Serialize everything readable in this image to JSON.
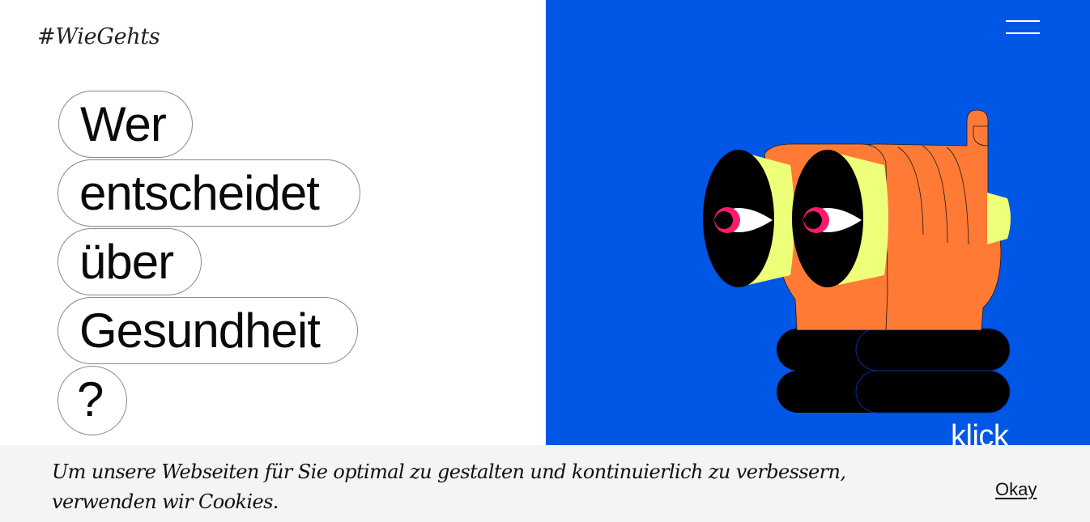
{
  "brand": {
    "logo": "#WieGehts"
  },
  "headline": {
    "words": [
      "Wer",
      "entscheidet",
      "über",
      "Gesundheit",
      "?"
    ]
  },
  "header": {
    "menu_icon": "hamburger-menu-icon"
  },
  "hero": {
    "illustration": "hands-binoculars-eyes-illustration",
    "cta_label": "klick"
  },
  "cookie_banner": {
    "message": "Um unsere Webseiten für Sie optimal zu gestalten und kontinuierlich zu verbessern, verwenden wir Cookies.",
    "accept_label": "Okay"
  },
  "colors": {
    "hero_background": "#0057e6",
    "hand": "#ff7a35",
    "binocular_rim": "#eeff7a",
    "iris": "#ff1a6e",
    "cookie_background": "#f4f4f2"
  }
}
